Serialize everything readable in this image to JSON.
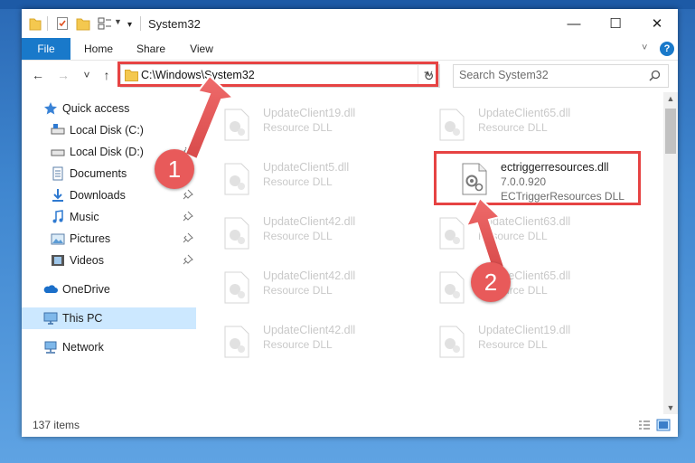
{
  "window": {
    "title": "System32",
    "controls": {
      "minimize": "—",
      "maximize": "☐",
      "close": "✕"
    }
  },
  "ribbon": {
    "tabs": [
      {
        "label": "File"
      },
      {
        "label": "Home"
      },
      {
        "label": "Share"
      },
      {
        "label": "View"
      }
    ],
    "expand_icon": "chevron-down-icon",
    "help_icon": "?"
  },
  "navbar": {
    "back_icon": "←",
    "forward_icon": "→",
    "recent_icon": "˅",
    "up_icon": "↑",
    "address": "C:\\Windows\\System32",
    "address_dropdown": "˅",
    "refresh_icon": "↻",
    "search_placeholder": "Search System32"
  },
  "sidebar": {
    "items": [
      {
        "label": "Quick access",
        "icon": "star-icon",
        "pinned": false
      },
      {
        "label": "Local Disk (C:)",
        "icon": "drive-icon",
        "pinned": true
      },
      {
        "label": "Local Disk (D:)",
        "icon": "drive-icon",
        "pinned": true
      },
      {
        "label": "Documents",
        "icon": "documents-icon",
        "pinned": true
      },
      {
        "label": "Downloads",
        "icon": "downloads-icon",
        "pinned": true
      },
      {
        "label": "Music",
        "icon": "music-icon",
        "pinned": true
      },
      {
        "label": "Pictures",
        "icon": "pictures-icon",
        "pinned": true
      },
      {
        "label": "Videos",
        "icon": "videos-icon",
        "pinned": true
      },
      {
        "label": "OneDrive",
        "icon": "cloud-icon",
        "pinned": false
      },
      {
        "label": "This PC",
        "icon": "computer-icon",
        "pinned": false,
        "selected": true
      },
      {
        "label": "Network",
        "icon": "network-icon",
        "pinned": false
      }
    ]
  },
  "files": [
    {
      "name": "UpdateClient19.dll",
      "type": "Resource DLL"
    },
    {
      "name": "UpdateClient65.dll",
      "type": "Resource DLL"
    },
    {
      "name": "UpdateClient5.dll",
      "type": "Resource DLL"
    },
    {
      "name": "ectriggerresources.dll",
      "type": "7.0.0.920",
      "description": "ECTriggerResources DLL",
      "highlighted": true
    },
    {
      "name": "UpdateClient42.dll",
      "type": "Resource DLL"
    },
    {
      "name": "UpdateClient63.dll",
      "type": "Resource DLL"
    },
    {
      "name": "UpdateClient42.dll",
      "type": "Resource DLL"
    },
    {
      "name": "UpdateClient65.dll",
      "type": "Resource DLL"
    },
    {
      "name": "UpdateClient42.dll",
      "type": "Resource DLL"
    },
    {
      "name": "UpdateClient19.dll",
      "type": "Resource DLL"
    }
  ],
  "status": {
    "item_count": "137 items"
  },
  "annotations": {
    "step1": "1",
    "step2": "2",
    "color": "#e64343"
  }
}
